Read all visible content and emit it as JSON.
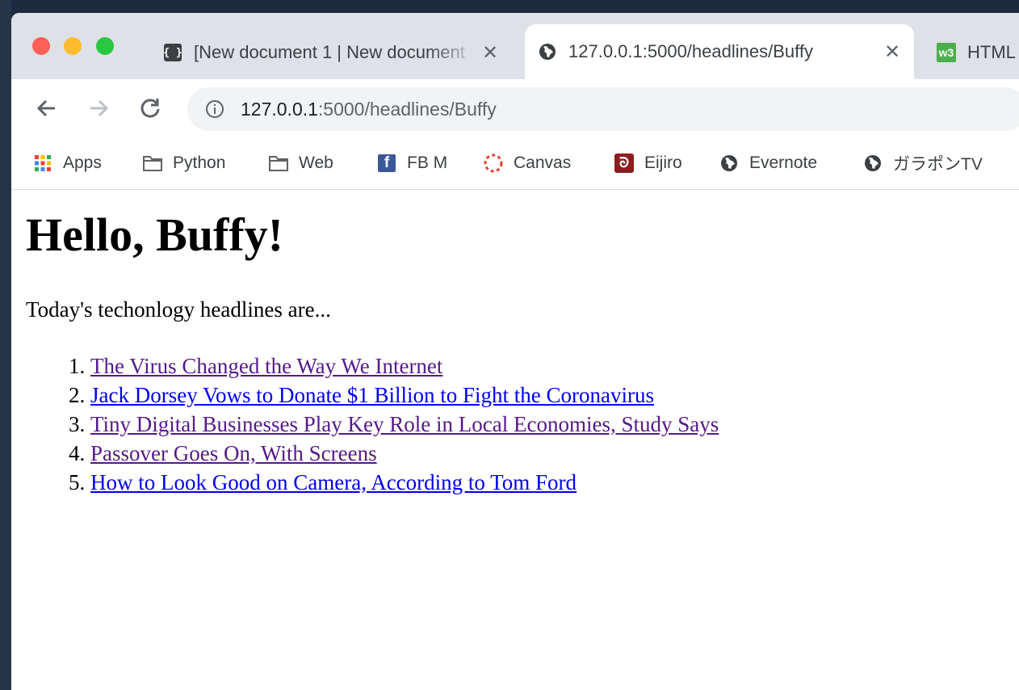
{
  "browser": {
    "tabs": [
      {
        "title": "[New document 1 | New document",
        "icon": "braces-icon",
        "close": "✕"
      },
      {
        "title": "127.0.0.1:5000/headlines/Buffy",
        "icon": "globe-icon",
        "close": "✕"
      },
      {
        "title": "HTML",
        "icon": "w3-icon"
      }
    ],
    "w3_badge": "w3",
    "address_bar": {
      "host": "127.0.0.1",
      "rest": ":5000/headlines/Buffy"
    },
    "bookmarks": [
      {
        "label": "Apps",
        "icon": "apps-grid-icon"
      },
      {
        "label": "Python",
        "icon": "folder-icon"
      },
      {
        "label": "Web",
        "icon": "folder-icon"
      },
      {
        "label": "FB M",
        "icon": "facebook-icon"
      },
      {
        "label": "Canvas",
        "icon": "canvas-icon"
      },
      {
        "label": "Eijiro",
        "icon": "eijiro-icon"
      },
      {
        "label": "Evernote",
        "icon": "globe-icon"
      },
      {
        "label": "ガラポンTV",
        "icon": "globe-icon"
      }
    ]
  },
  "page": {
    "heading": "Hello, Buffy!",
    "intro": "Today's techonlogy headlines are...",
    "headlines": [
      {
        "title": "The Virus Changed the Way We Internet",
        "visited": true
      },
      {
        "title": "Jack Dorsey Vows to Donate $1 Billion to Fight the Coronavirus",
        "visited": false
      },
      {
        "title": "Tiny Digital Businesses Play Key Role in Local Economies, Study Says",
        "visited": true
      },
      {
        "title": "Passover Goes On, With Screens",
        "visited": true
      },
      {
        "title": "How to Look Good on Camera, According to Tom Ford",
        "visited": false
      }
    ]
  },
  "colors": {
    "link": "#0000ee",
    "visited_link": "#551a8b",
    "tabstrip": "#dee1e6"
  }
}
